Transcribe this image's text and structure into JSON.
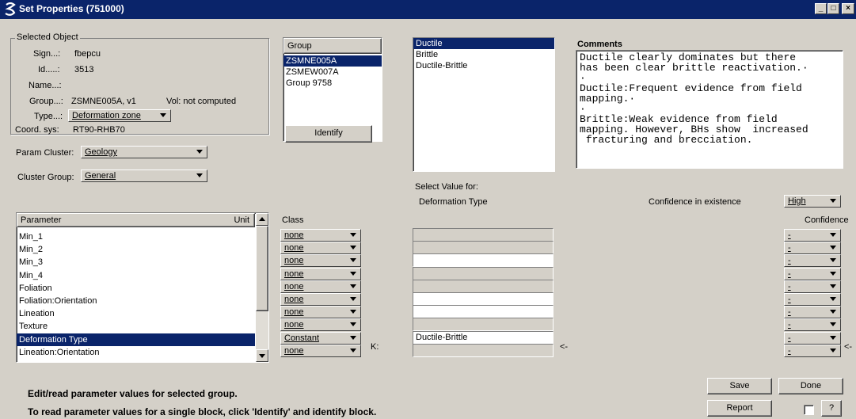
{
  "window": {
    "title": "Set Properties (751000)"
  },
  "selected_object": {
    "title": "Selected Object",
    "sign_label": "Sign...:",
    "sign": "fbepcu",
    "id_label": "Id.....:",
    "id": "3513",
    "name_label": "Name...:",
    "group_label": "Group...:",
    "group": "ZSMNE005A, v1",
    "vol": "Vol: not computed",
    "type_label": "Type...:",
    "type": "Deformation zone",
    "coord_label": "Coord. sys:",
    "coord": "RT90-RHB70"
  },
  "param_cluster": {
    "label": "Param Cluster:",
    "value": "Geology"
  },
  "cluster_group": {
    "label": "Cluster Group:",
    "value": "General"
  },
  "group_list": {
    "header": "Group",
    "items": [
      "ZSMNE005A",
      "ZSMEW007A",
      "Group 9758"
    ],
    "selected": 0
  },
  "identify_button": "Identify",
  "value_list": {
    "items": [
      "Ductile",
      "Brittle",
      "Ductile-Brittle"
    ],
    "selected": 0
  },
  "comments": {
    "title": "Comments",
    "text": "Ductile clearly dominates but there\nhas been clear brittle reactivation.·\n·\nDuctile:Frequent evidence from field\nmapping.·\n·\nBrittle:Weak evidence from field\nmapping. However, BHs show  increased\n fracturing and brecciation."
  },
  "select_value": {
    "label": "Select Value for:",
    "param": "Deformation Type"
  },
  "confidence_existence": {
    "label": "Confidence in existence",
    "value": "High"
  },
  "param_table": {
    "col_param": "Parameter",
    "col_unit": "Unit",
    "rows": [
      "Min_1",
      "Min_2",
      "Min_3",
      "Min_4",
      "Foliation",
      "Foliation:Orientation",
      "Lineation",
      "Texture",
      "Deformation Type",
      "Lineation:Orientation"
    ],
    "selected": 8
  },
  "class_header": "Class",
  "class_values": [
    "none",
    "none",
    "none",
    "none",
    "none",
    "none",
    "none",
    "none",
    "Constant",
    "none"
  ],
  "k_label": "K:",
  "value_fields": [
    "",
    "",
    "",
    "",
    "",
    "",
    "",
    "",
    "Ductile-Brittle",
    ""
  ],
  "arrow_marker": "<-",
  "confidence_header": "Confidence",
  "confidence_values": [
    "-",
    "-",
    "-",
    "-",
    "-",
    "-",
    "-",
    "-",
    "-",
    "-"
  ],
  "footer": {
    "line1": "Edit/read parameter values for selected group.",
    "line2": "To read parameter values for a single block, click 'Identify' and identify block."
  },
  "buttons": {
    "save": "Save",
    "done": "Done",
    "report": "Report",
    "help": "?"
  },
  "titlebar_buttons": {
    "minimize": "_",
    "maximize": "□",
    "close": "×"
  },
  "colors": {
    "titlebar": "#0a246a",
    "face": "#d4d0c8",
    "selection": "#0a246a"
  }
}
